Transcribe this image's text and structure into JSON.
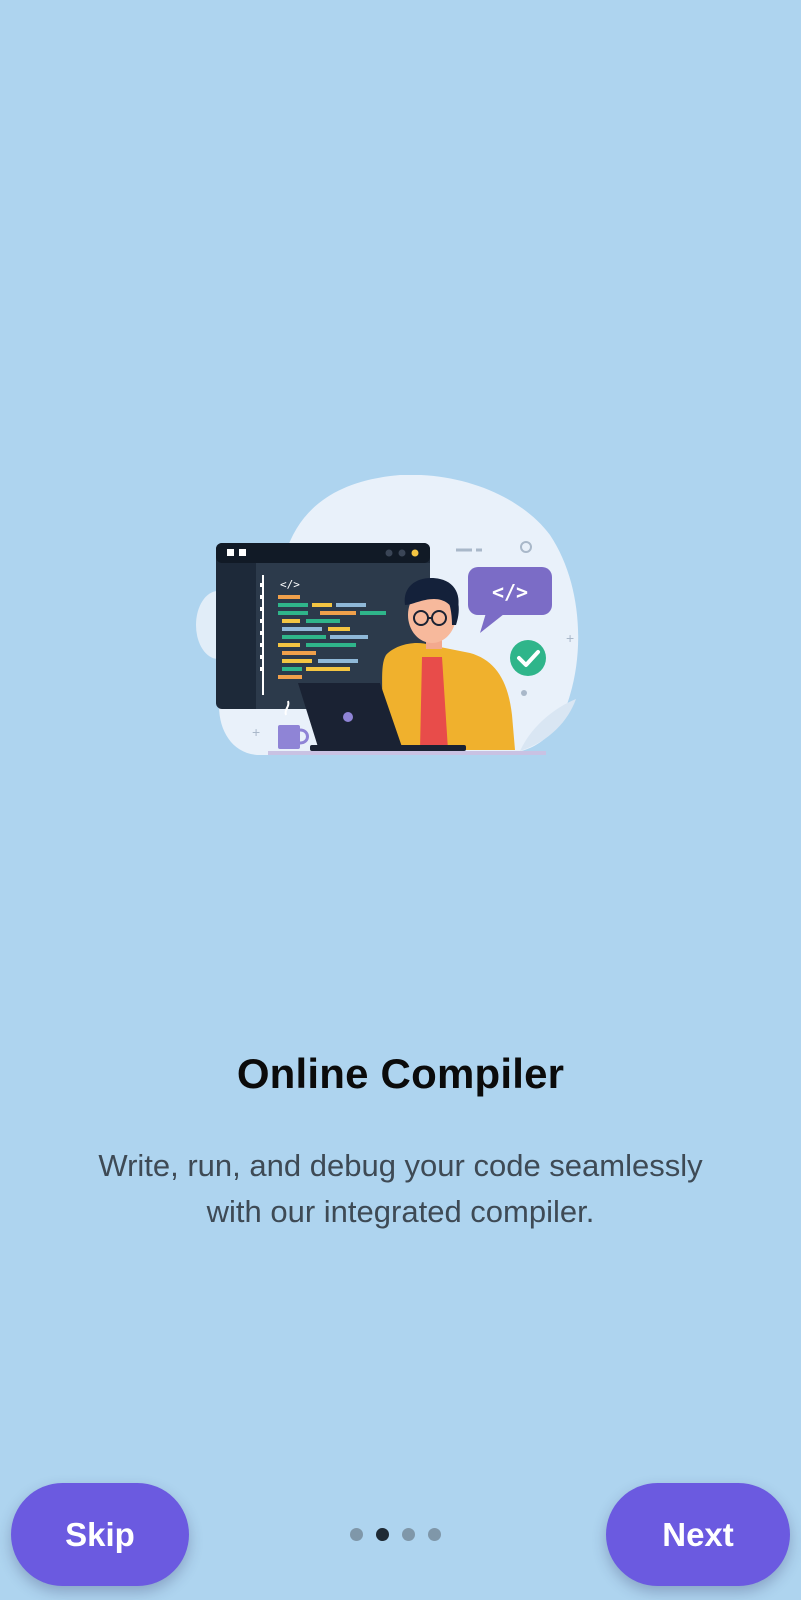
{
  "onboarding": {
    "title": "Online Compiler",
    "description_line1": "Write, run, and debug your code seamlessly",
    "description_line2": "with our integrated compiler.",
    "illustration": {
      "speech_bubble_code": "</>",
      "editor_tag": "</>",
      "icons": [
        "code-editor-window",
        "speech-bubble-icon",
        "check-icon",
        "coffee-mug-icon",
        "laptop-icon"
      ]
    }
  },
  "footer": {
    "skip_label": "Skip",
    "next_label": "Next",
    "page_indicator": {
      "total": 4,
      "active_index": 1
    }
  },
  "colors": {
    "background": "#aed4ef",
    "button": "#6b5ae0",
    "dot_active": "#1f2a34",
    "dot_inactive": "#7f97a9"
  }
}
